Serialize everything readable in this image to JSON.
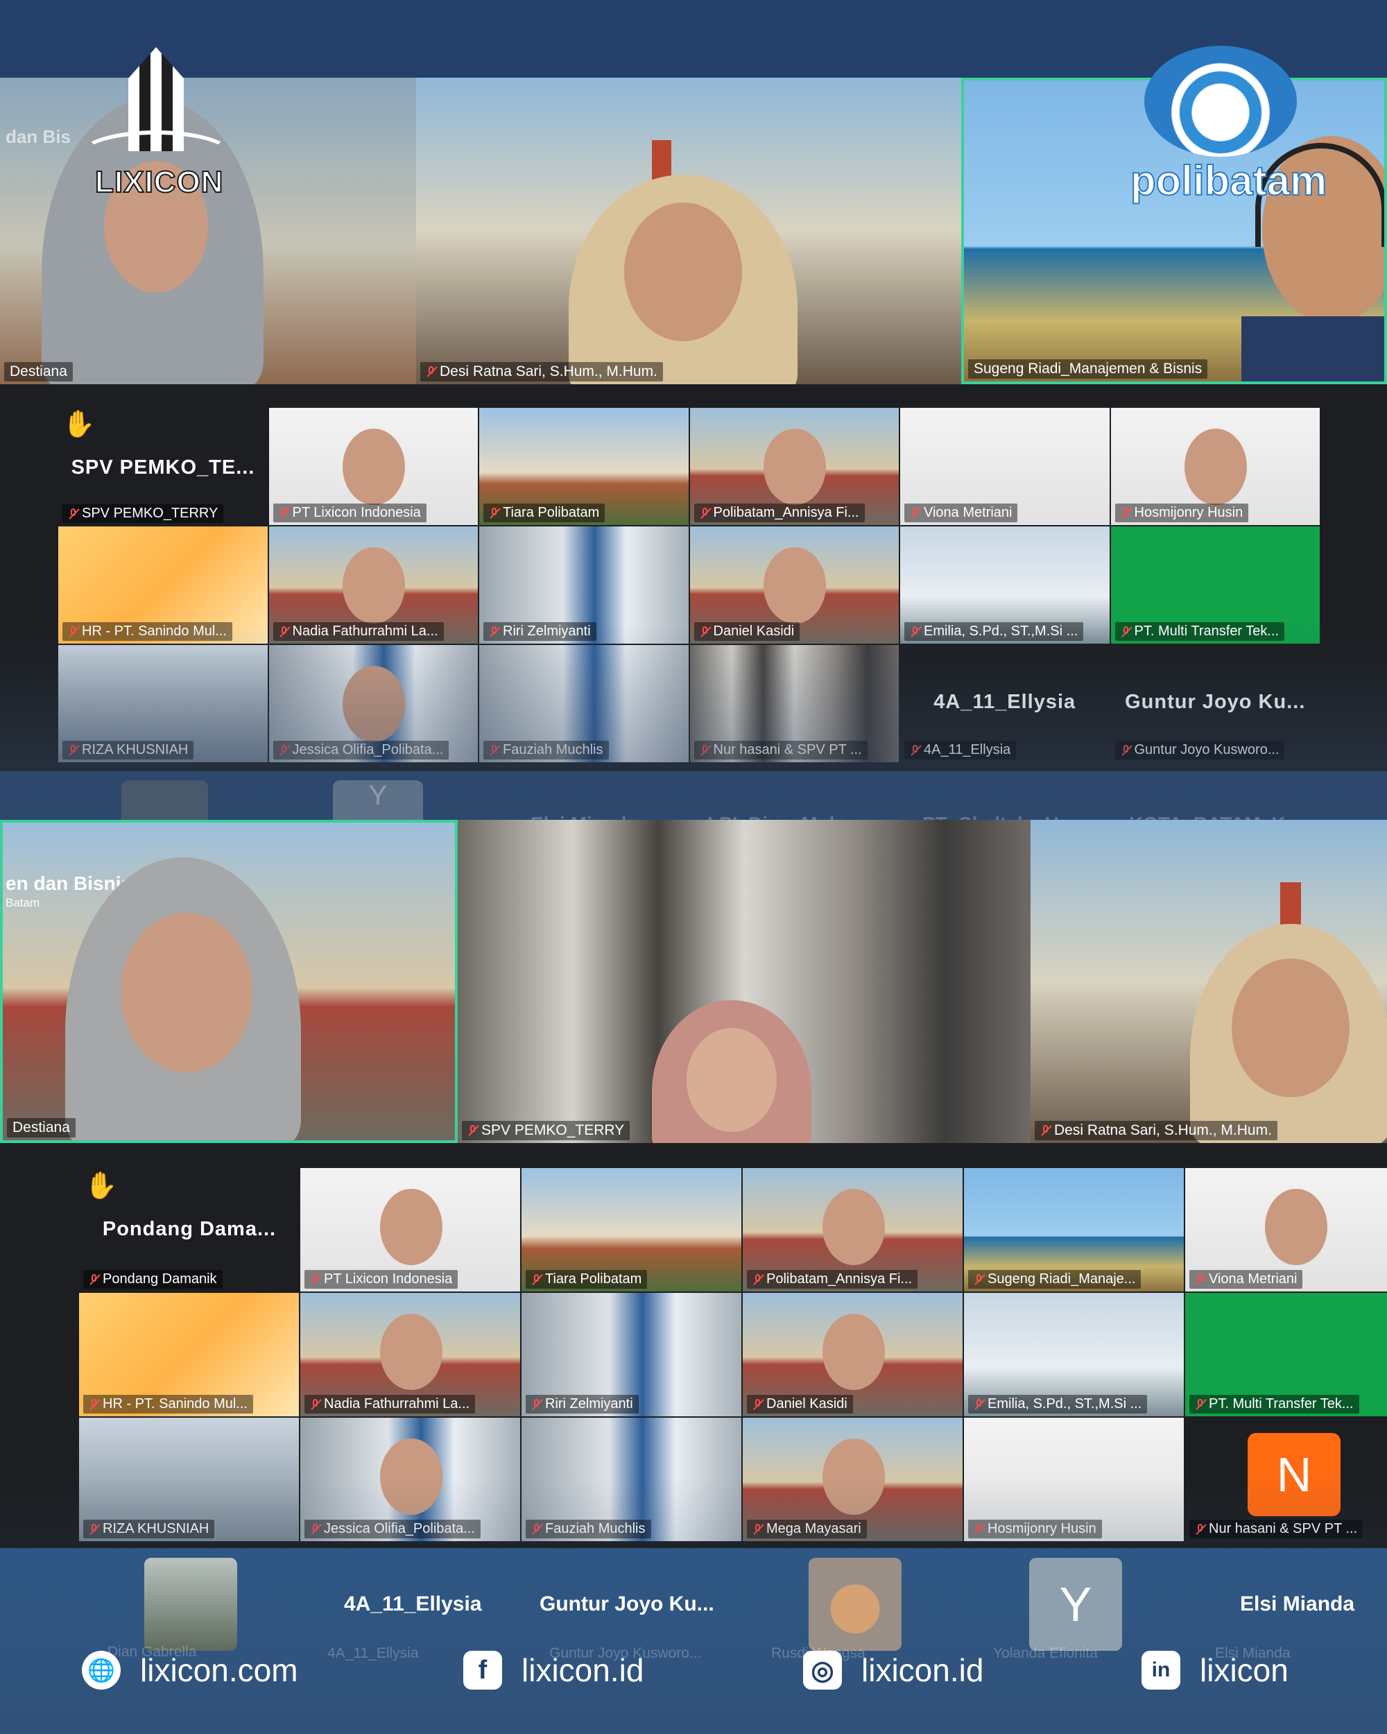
{
  "brand": {
    "logo_text": "LIXICON",
    "partner_logo_text": "polibatam"
  },
  "screen1": {
    "speakers": [
      {
        "name": "Destiana"
      },
      {
        "name": "Desi Ratna Sari, S.Hum., M.Hum."
      },
      {
        "name": "Sugeng Riadi_Manajemen & Bisnis"
      }
    ],
    "bg_text_left": "dan Bis",
    "raised_hand_name": "SPV  PEMKO_TE...",
    "grid": [
      "SPV PEMKO_TERRY",
      "PT Lixicon Indonesia",
      "Tiara Polibatam",
      "Polibatam_Annisya Fi...",
      "Viona Metriani",
      "Hosmijonry Husin",
      "HR - PT. Sanindo Mul...",
      "Nadia Fathurrahmi La...",
      "Riri Zelmiyanti",
      "Daniel Kasidi",
      "Emilia, S.Pd., ST.,M.Si ...",
      "PT. Multi Transfer Tek...",
      "RIZA KHUSNIAH",
      "Jessica Olifia_Polibata...",
      "Fauziah Muchlis",
      "Nur hasani & SPV PT ...",
      "4A_11_Ellysia",
      "Guntur Joyo Kusworo..."
    ],
    "text_only_tiles": [
      "4A_11_Ellysia",
      "Guntur Joyo Ku..."
    ],
    "ghost_row": [
      "Elsi Mianda",
      "LPI_Dian_Mulya...",
      "PT_Cladtek - Vera",
      "KOTA_BATAM_K..."
    ],
    "ghost_avatar": "Y"
  },
  "screen2": {
    "speakers": [
      {
        "name": "Destiana",
        "bg_text": "en dan Bisnis",
        "bg_sub": "Batam"
      },
      {
        "name": "SPV PEMKO_TERRY"
      },
      {
        "name": "Desi Ratna Sari, S.Hum., M.Hum."
      }
    ],
    "raised_hand_name": "Pondang  Dama...",
    "grid": [
      "Pondang Damanik",
      "PT Lixicon Indonesia",
      "Tiara Polibatam",
      "Polibatam_Annisya Fi...",
      "Sugeng Riadi_Manaje...",
      "Viona Metriani",
      "HR - PT. Sanindo Mul...",
      "Nadia Fathurrahmi La...",
      "Riri Zelmiyanti",
      "Daniel Kasidi",
      "Emilia, S.Pd., ST.,M.Si ...",
      "PT. Multi Transfer Tek...",
      "RIZA KHUSNIAH",
      "Jessica Olifia_Polibata...",
      "Fauziah Muchlis",
      "Mega Mayasari",
      "Hosmijonry Husin",
      "Nur hasani & SPV PT ..."
    ],
    "avatar_letter_n": "N",
    "bottom_row": [
      {
        "name": "Dian Gabrella"
      },
      {
        "name": "4A_11_Ellysia",
        "big": "4A_11_Ellysia"
      },
      {
        "name": "Guntur Joyo Kusworo...",
        "big": "Guntur Joyo Ku..."
      },
      {
        "name": "Rusdi Wangsa"
      },
      {
        "name": "Yolanda Efionita",
        "letter": "Y"
      },
      {
        "name": "Elsi Mianda",
        "big": "Elsi Mianda"
      }
    ]
  },
  "footer": {
    "website": "lixicon.com",
    "facebook": "lixicon.id",
    "instagram": "lixicon.id",
    "linkedin": "lixicon",
    "facebook_icon": "f",
    "instagram_icon": "◎",
    "linkedin_icon": "in",
    "website_icon": "🌐"
  }
}
